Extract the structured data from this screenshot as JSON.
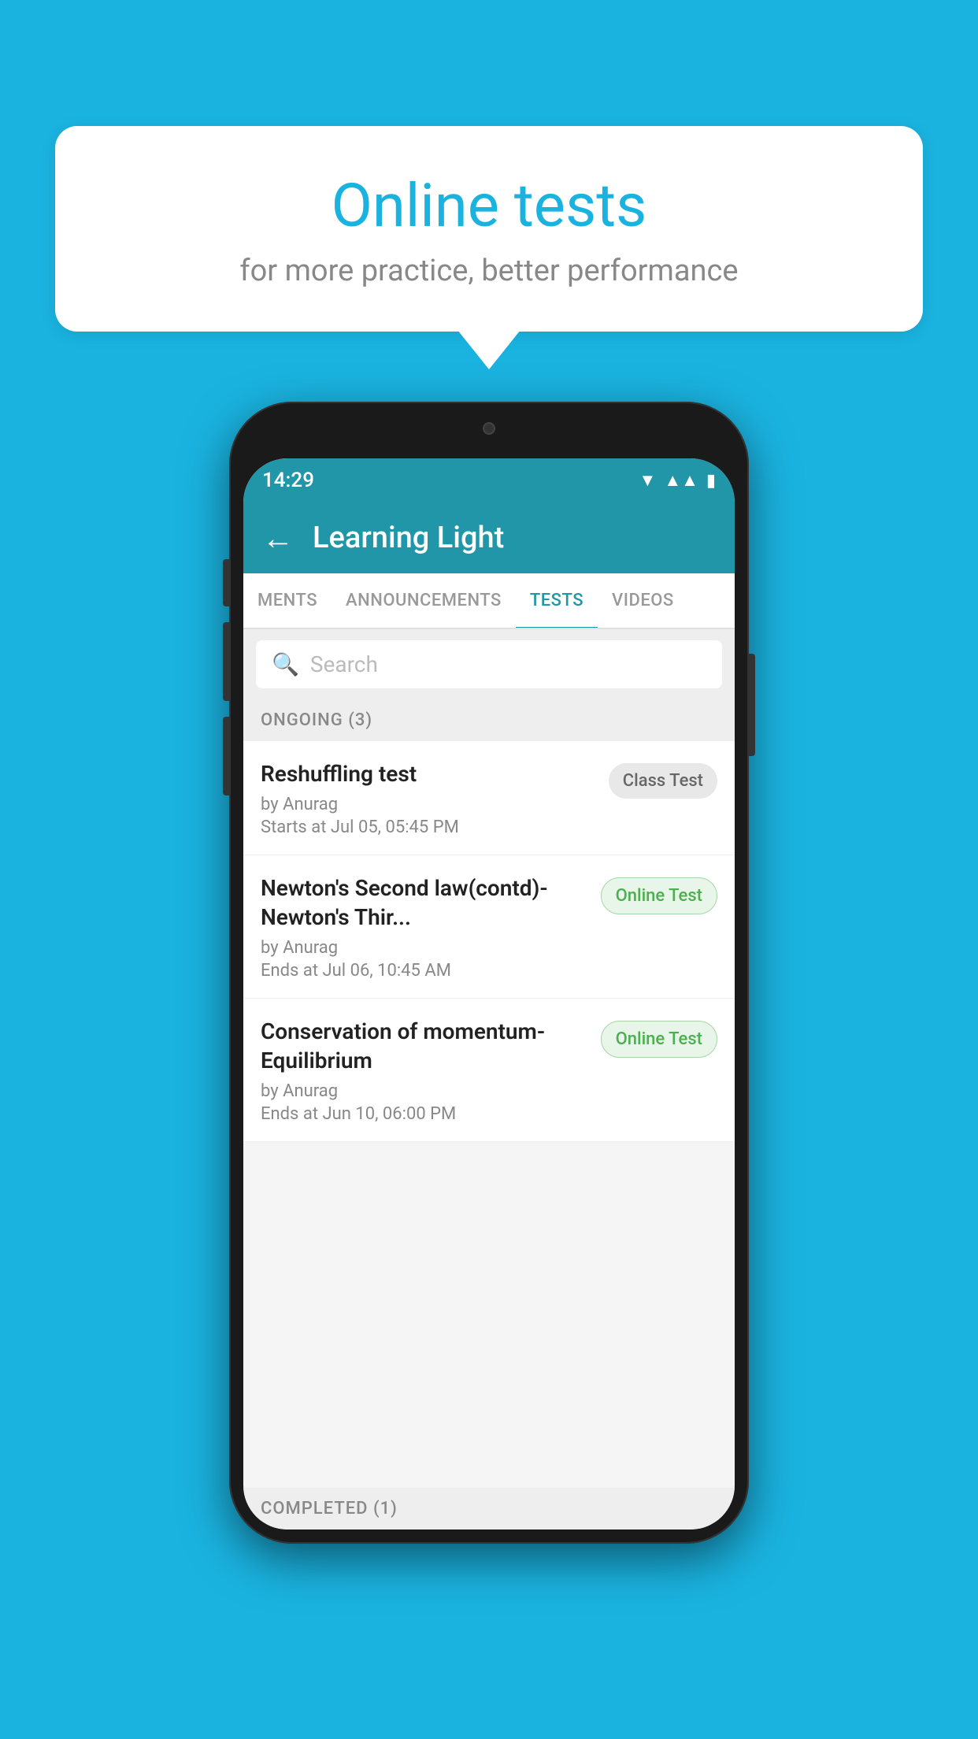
{
  "background": {
    "color": "#1ab3e0"
  },
  "speech_bubble": {
    "title": "Online tests",
    "subtitle": "for more practice, better performance"
  },
  "phone": {
    "status_bar": {
      "time": "14:29",
      "icons": [
        "wifi",
        "signal",
        "battery"
      ]
    },
    "header": {
      "back_label": "←",
      "title": "Learning Light"
    },
    "tabs": [
      {
        "label": "MENTS",
        "active": false
      },
      {
        "label": "ANNOUNCEMENTS",
        "active": false
      },
      {
        "label": "TESTS",
        "active": true
      },
      {
        "label": "VIDEOS",
        "active": false
      }
    ],
    "search": {
      "placeholder": "Search",
      "icon": "🔍"
    },
    "ongoing_section": {
      "label": "ONGOING (3)",
      "tests": [
        {
          "name": "Reshuffling test",
          "author": "by Anurag",
          "time_label": "Starts at",
          "time": "Jul 05, 05:45 PM",
          "badge": "Class Test",
          "badge_type": "class"
        },
        {
          "name": "Newton's Second law(contd)-Newton's Thir...",
          "author": "by Anurag",
          "time_label": "Ends at",
          "time": "Jul 06, 10:45 AM",
          "badge": "Online Test",
          "badge_type": "online"
        },
        {
          "name": "Conservation of momentum-Equilibrium",
          "author": "by Anurag",
          "time_label": "Ends at",
          "time": "Jun 10, 06:00 PM",
          "badge": "Online Test",
          "badge_type": "online"
        }
      ]
    },
    "completed_section": {
      "label": "COMPLETED (1)"
    }
  }
}
